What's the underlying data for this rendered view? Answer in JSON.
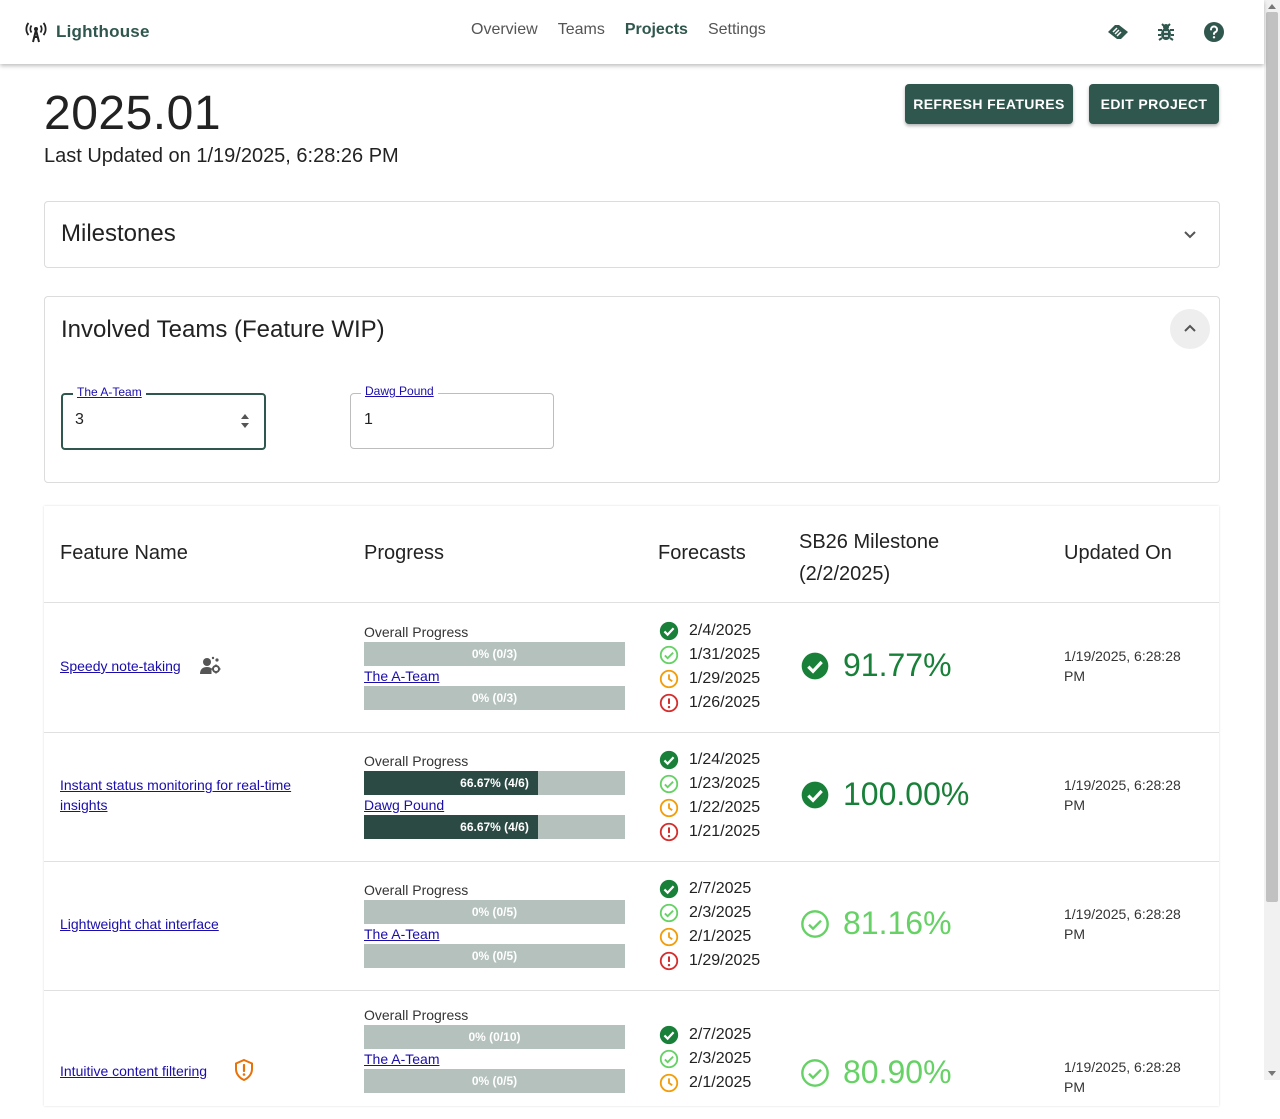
{
  "app": {
    "brand": "Lighthouse",
    "nav": [
      "Overview",
      "Teams",
      "Projects",
      "Settings"
    ],
    "active_nav": "Projects",
    "toolbar_icons": [
      "handshake-icon",
      "bug-icon",
      "help-icon"
    ]
  },
  "header": {
    "title": "2025.01",
    "last_updated": "Last Updated on 1/19/2025, 6:28:26 PM",
    "refresh_label": "REFRESH FEATURES",
    "edit_label": "EDIT PROJECT"
  },
  "milestones_panel": {
    "title": "Milestones",
    "expanded": false
  },
  "teams_panel": {
    "title": "Involved Teams (Feature WIP)",
    "expanded": true,
    "teams": [
      {
        "name": "The A-Team",
        "value": "3"
      },
      {
        "name": "Dawg Pound",
        "value": "1"
      }
    ]
  },
  "table": {
    "headers": {
      "name": "Feature Name",
      "progress": "Progress",
      "forecasts": "Forecasts",
      "milestone_line1": "SB26 Milestone",
      "milestone_line2": "(2/2/2025)",
      "updated": "Updated On"
    },
    "overall_label": "Overall Progress",
    "rows": [
      {
        "name": "Speedy note-taking",
        "icon": "team-settings-icon",
        "overall": {
          "text": "0% (0/3)",
          "fraction": 0.0
        },
        "team": "The A-Team",
        "team_progress": {
          "text": "0% (0/3)",
          "fraction": 0.0
        },
        "forecasts": [
          "2/4/2025",
          "1/31/2025",
          "1/29/2025",
          "1/26/2025"
        ],
        "milestone_pct": "91.77%",
        "updated_line1": "1/19/2025, 6:28:28",
        "updated_line2": "PM"
      },
      {
        "name_line1": "Instant status monitoring for real-time",
        "name_line2": "insights",
        "overall": {
          "text": "66.67% (4/6)",
          "fraction": 0.6667
        },
        "team": "Dawg Pound",
        "team_progress": {
          "text": "66.67% (4/6)",
          "fraction": 0.6667
        },
        "forecasts": [
          "1/24/2025",
          "1/23/2025",
          "1/22/2025",
          "1/21/2025"
        ],
        "milestone_pct": "100.00%",
        "updated_line1": "1/19/2025, 6:28:28",
        "updated_line2": "PM"
      },
      {
        "name": "Lightweight chat interface",
        "overall": {
          "text": "0% (0/5)",
          "fraction": 0.0
        },
        "team": "The A-Team",
        "team_progress": {
          "text": "0% (0/5)",
          "fraction": 0.0
        },
        "forecasts": [
          "2/7/2025",
          "2/3/2025",
          "2/1/2025",
          "1/29/2025"
        ],
        "milestone_pct": "81.16%",
        "updated_line1": "1/19/2025, 6:28:28",
        "updated_line2": "PM"
      },
      {
        "name": "Intuitive content filtering",
        "icon": "shield-warning-icon",
        "overall": {
          "text": "0% (0/10)",
          "fraction": 0.0
        },
        "team": "The A-Team",
        "team_progress": {
          "text": "0% (0/5)",
          "fraction": 0.0
        },
        "forecasts": [
          "2/7/2025",
          "2/3/2025",
          "2/1/2025"
        ],
        "milestone_pct": "80.90%",
        "updated_line1": "1/19/2025, 6:28:28",
        "updated_line2": "PM"
      }
    ],
    "forecast_icons": [
      "check-circle-filled-icon",
      "check-circle-outline-icon",
      "clock-icon",
      "alert-circle-icon"
    ]
  },
  "colors": {
    "primary": "#30574e",
    "bar_track": "#b4c1bd",
    "bar_fill": "#2c4a44",
    "dark_green": "#188038",
    "light_green": "#66d165",
    "orange": "#f29d0a",
    "red": "#d32f2f",
    "link": "#1a0dab"
  }
}
